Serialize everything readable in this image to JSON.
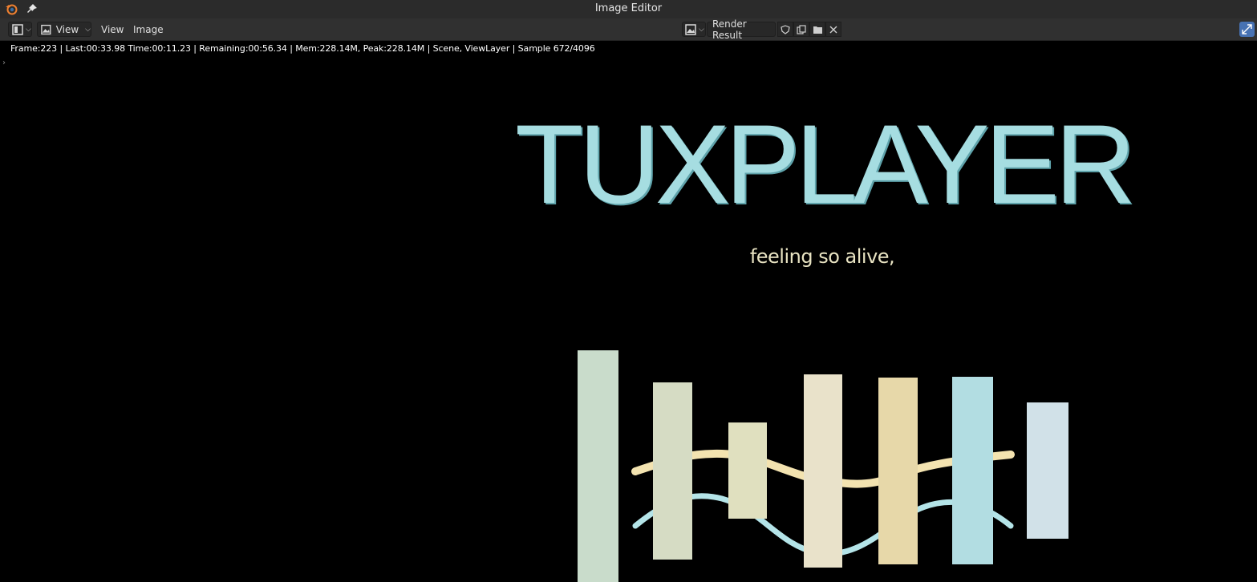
{
  "window": {
    "title": "Image Editor"
  },
  "header": {
    "editor_type_icon": "image-editor-icon",
    "view_mode_label": "View",
    "menu_view": "View",
    "menu_image": "Image",
    "image_name": "Render Result",
    "icons": [
      "shield-icon",
      "duplicate-icon",
      "folder-icon",
      "close-icon"
    ]
  },
  "status": {
    "text": "Frame:223 | Last:00:33.98 Time:00:11.23 | Remaining:00:56.34 | Mem:228.14M, Peak:228.14M | Scene, ViewLayer | Sample 672/4096"
  },
  "render": {
    "title": "TUXPLAYER",
    "subtitle": "feeling so alive,",
    "colors": {
      "title": "#a6dde1",
      "subtitle": "#e8e3c2",
      "wave_yellow": "#f3e3b0",
      "wave_cyan": "#b4e4e8"
    },
    "bars": [
      {
        "color": "#c9dccb"
      },
      {
        "color": "#d6dcc4"
      },
      {
        "color": "#e0e0bf"
      },
      {
        "color": "#e9e2ca"
      },
      {
        "color": "#e7d8a9"
      },
      {
        "color": "#b2dde2"
      },
      {
        "color": "#d1e1e8"
      }
    ]
  }
}
